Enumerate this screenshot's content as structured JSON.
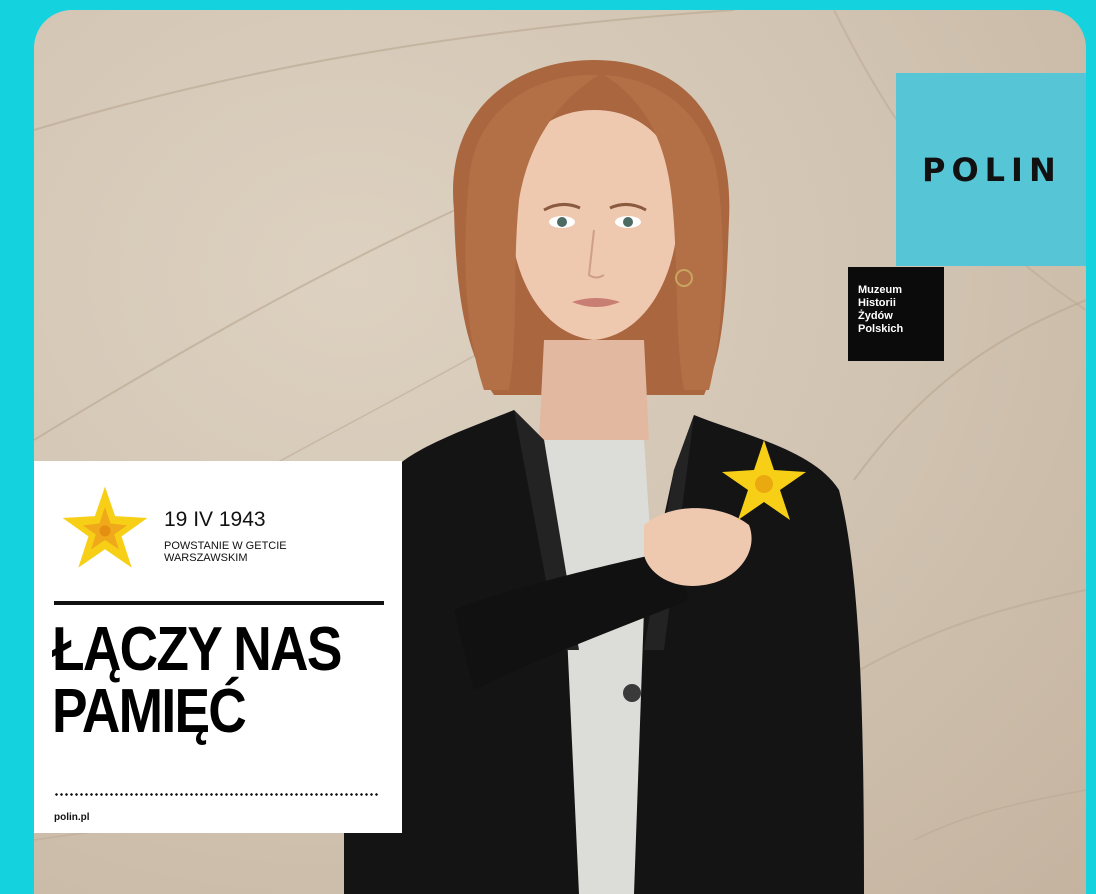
{
  "logo": {
    "name": "POLIN",
    "museum_lines": [
      "Muzeum",
      "Historii",
      "Żydów",
      "Polskich"
    ]
  },
  "panel": {
    "date": "19 IV 1943",
    "uprising_lines": [
      "POWSTANIE W GETCIE",
      "WARSZAWSKIM"
    ],
    "headline_lines": [
      "ŁĄCZY NAS",
      "PAMIĘĆ"
    ],
    "url": "polin.pl"
  },
  "colors": {
    "frame": "#15d3de",
    "logo_block": "#56c5d5",
    "daffodil": "#f6cf16",
    "jacket": "#111111"
  },
  "icons": [
    "daffodil-icon"
  ]
}
